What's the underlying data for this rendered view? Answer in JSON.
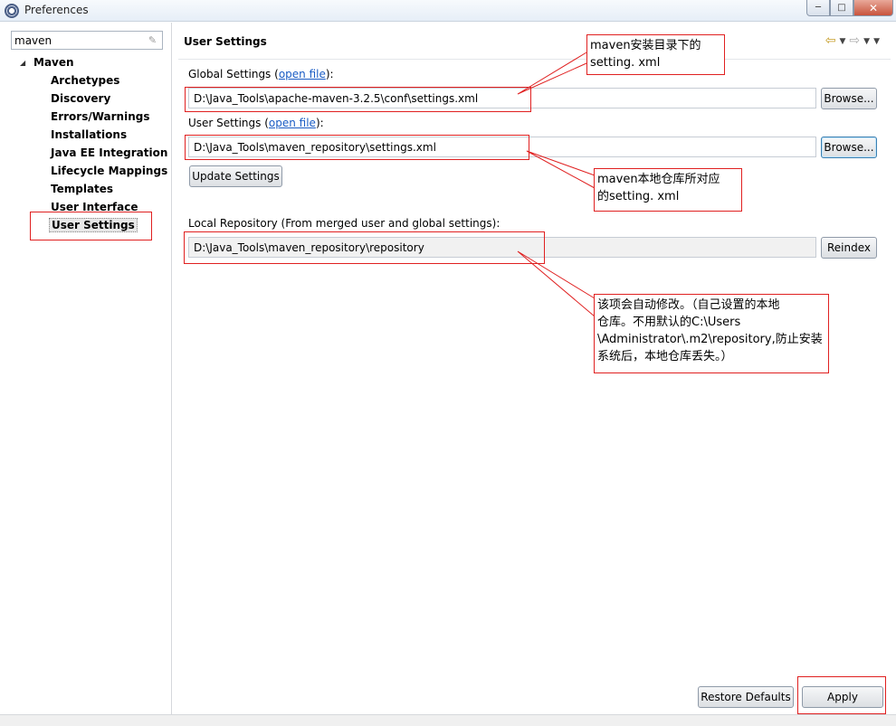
{
  "window": {
    "title": "Preferences"
  },
  "filter": {
    "value": "maven"
  },
  "tree": {
    "root": "Maven",
    "items": [
      "Archetypes",
      "Discovery",
      "Errors/Warnings",
      "Installations",
      "Java EE Integration",
      "Lifecycle Mappings",
      "Templates",
      "User Interface",
      "User Settings"
    ],
    "selected": "User Settings"
  },
  "page": {
    "title": "User Settings",
    "global_label_pre": "Global Settings (",
    "global_link": "open file",
    "global_label_post": "):",
    "global_path": "D:\\Java_Tools\\apache-maven-3.2.5\\conf\\settings.xml",
    "user_label_pre": "User Settings (",
    "user_link": "open file",
    "user_label_post": "):",
    "user_path": "D:\\Java_Tools\\maven_repository\\settings.xml",
    "browse_label": "Browse...",
    "update_label": "Update Settings",
    "local_repo_label": "Local Repository (From merged user and global settings):",
    "local_repo_path": "D:\\Java_Tools\\maven_repository\\repository",
    "reindex_label": "Reindex",
    "restore_defaults_label": "Restore Defaults",
    "apply_label": "Apply"
  },
  "annotations": {
    "global_note_1": "maven安装目录下的",
    "global_note_2": "setting. xml",
    "user_note_1": "maven本地仓库所对应",
    "user_note_2": "的setting. xml",
    "repo_note_1": "该项会自动修改。（自己设置的本地",
    "repo_note_2": "仓库。不用默认的C:\\Users",
    "repo_note_3": "\\Administrator\\.m2\\repository,防止安装",
    "repo_note_4": "系统后，本地仓库丢失。）"
  }
}
